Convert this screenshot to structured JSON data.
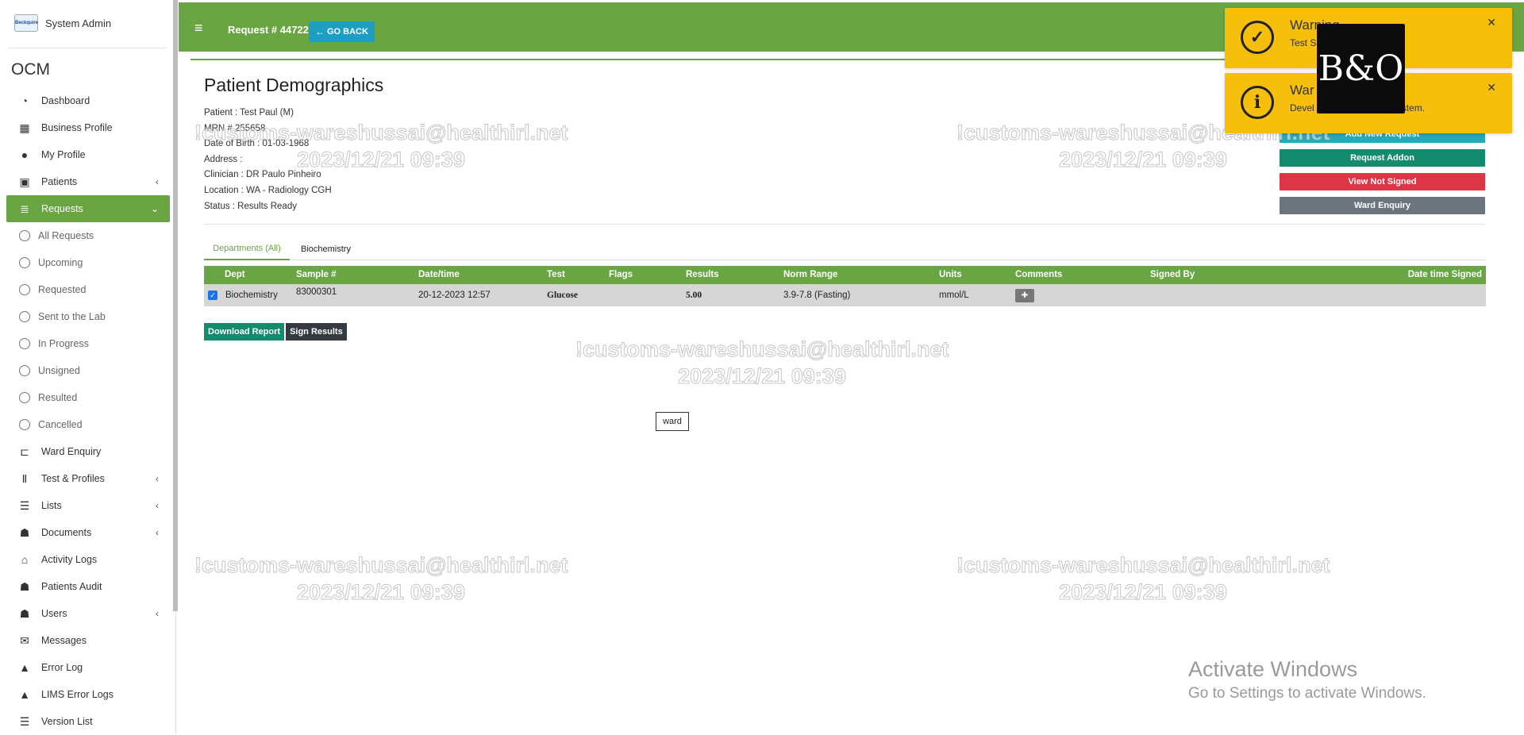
{
  "sidebar": {
    "user_name": "System Admin",
    "logo_text": "Beckquire",
    "brand": "OCM",
    "items": [
      {
        "label": "Dashboard",
        "icon": "dashboard-icon",
        "glyph": "◔"
      },
      {
        "label": "Business Profile",
        "icon": "building-icon",
        "glyph": "▦"
      },
      {
        "label": "My Profile",
        "icon": "user-icon",
        "glyph": "●"
      },
      {
        "label": "Patients",
        "icon": "id-card-icon",
        "glyph": "▣",
        "chevron": "‹"
      },
      {
        "label": "Requests",
        "icon": "database-icon",
        "glyph": "≣",
        "chevron": "⌄",
        "active": true
      }
    ],
    "sub_items": [
      {
        "label": "All Requests"
      },
      {
        "label": "Upcoming"
      },
      {
        "label": "Requested"
      },
      {
        "label": "Sent to the Lab"
      },
      {
        "label": "In Progress"
      },
      {
        "label": "Unsigned"
      },
      {
        "label": "Resulted"
      },
      {
        "label": "Cancelled"
      }
    ],
    "items_after": [
      {
        "label": "Ward Enquiry",
        "icon": "bed-icon",
        "glyph": "⊏"
      },
      {
        "label": "Test & Profiles",
        "icon": "test-tubes-icon",
        "glyph": "Ⅱ",
        "chevron": "‹"
      },
      {
        "label": "Lists",
        "icon": "list-icon",
        "glyph": "☰",
        "chevron": "‹"
      },
      {
        "label": "Documents",
        "icon": "users-icon",
        "glyph": "☗",
        "chevron": "‹"
      },
      {
        "label": "Activity Logs",
        "icon": "institution-icon",
        "glyph": "⌂"
      },
      {
        "label": "Patients Audit",
        "icon": "users-icon",
        "glyph": "☗"
      },
      {
        "label": "Users",
        "icon": "users-icon",
        "glyph": "☗",
        "chevron": "‹"
      },
      {
        "label": "Messages",
        "icon": "envelope-icon",
        "glyph": "✉"
      },
      {
        "label": "Error Log",
        "icon": "warning-icon",
        "glyph": "▲"
      },
      {
        "label": "LIMS Error Logs",
        "icon": "warning-icon",
        "glyph": "▲"
      },
      {
        "label": "Version List",
        "icon": "list-icon",
        "glyph": "☰"
      }
    ]
  },
  "header": {
    "menu_glyph": "≡",
    "request_title": "Request # 44722",
    "go_back": "GO BACK",
    "go_back_glyph": "←"
  },
  "main": {
    "title": "Patient Demographics",
    "demographics": [
      "Patient : Test Paul (M)",
      "MRN # 255658",
      "Date of Birth : 01-03-1968",
      "Address :",
      "Clinician : DR Paulo Pinheiro",
      "Location : WA - Radiology CGH",
      "Status : Results Ready"
    ],
    "actions": {
      "add_new_request": "Add New Request",
      "request_addon": "Request Addon",
      "view_not_signed": "View Not Signed",
      "ward_enquiry": "Ward Enquiry"
    },
    "tabs": [
      "Departments (All)",
      "Biochemistry"
    ],
    "table": {
      "headers": [
        "Dept",
        "Sample #",
        "Date/time",
        "Test",
        "Flags",
        "Results",
        "Norm Range",
        "Units",
        "Comments",
        "Signed By",
        "Date time Signed"
      ],
      "rows": [
        {
          "checked": true,
          "dept": "Biochemistry",
          "sample": "83000301",
          "datetime": "20-12-2023 12:57",
          "test": "Glucose",
          "flags": "",
          "results": "5.00",
          "norm_range": "3.9-7.8 (Fasting)",
          "units": "mmol/L",
          "signed_by": "",
          "date_signed": ""
        }
      ]
    },
    "download_report": "Download Report",
    "sign_results": "Sign Results",
    "tooltip": "ward"
  },
  "watermark": {
    "line1": "!customs-wareshussai@healthirl.net",
    "line2": "2023/12/21 09:39"
  },
  "activate_windows": {
    "title": "Activate Windows",
    "subtitle": "Go to Settings to activate Windows."
  },
  "toasts": [
    {
      "title": "Warning",
      "message": "Test S",
      "icon": "check-circle-icon",
      "glyph": "✓"
    },
    {
      "title": "War",
      "message": "Devel",
      "message_tail": "n the system.",
      "icon": "info-circle-icon",
      "glyph": "i"
    }
  ],
  "overlay_logo": {
    "icon": "bo-logo-icon",
    "text": "B&O"
  },
  "colors": {
    "primary_green": "#6aa544",
    "teal": "#26a9b8",
    "dark_green": "#138b6c",
    "red": "#dc3545",
    "gray": "#6c757d",
    "warning": "#f5bf0c",
    "info_blue": "#1f9ec3"
  }
}
